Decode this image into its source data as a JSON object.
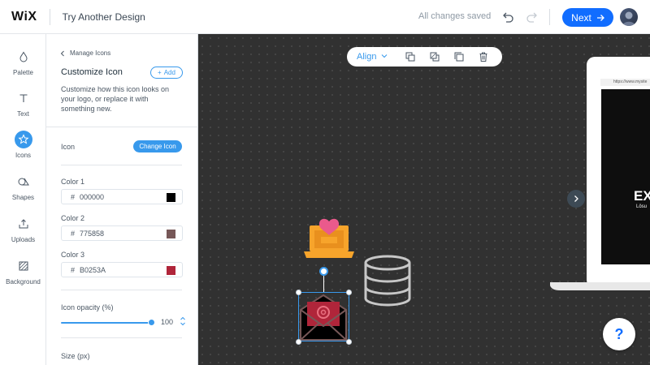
{
  "header": {
    "logo": "WiX",
    "title": "Try Another Design",
    "status": "All changes saved",
    "next_label": "Next"
  },
  "toolstrip": {
    "items": [
      {
        "label": "Palette",
        "icon": "palette-icon"
      },
      {
        "label": "Text",
        "icon": "text-icon"
      },
      {
        "label": "Icons",
        "icon": "star-icon",
        "active": true
      },
      {
        "label": "Shapes",
        "icon": "shapes-icon"
      },
      {
        "label": "Uploads",
        "icon": "upload-icon"
      },
      {
        "label": "Background",
        "icon": "background-icon"
      }
    ]
  },
  "panel": {
    "breadcrumb": "Manage Icons",
    "title": "Customize Icon",
    "add_label": "Add",
    "description": "Customize how this icon looks on your logo, or replace it with something new.",
    "icon_label": "Icon",
    "change_label": "Change Icon",
    "colors": [
      {
        "label": "Color 1",
        "hex": "000000",
        "swatch": "#000000"
      },
      {
        "label": "Color 2",
        "hex": "775858",
        "swatch": "#775858"
      },
      {
        "label": "Color 3",
        "hex": "B0253A",
        "swatch": "#B0253A"
      }
    ],
    "opacity_label": "Icon opacity (%)",
    "opacity_value": "100",
    "size_label": "Size (px)"
  },
  "canvas": {
    "align_label": "Align",
    "url_text": "https://www.mysite",
    "preview_text": "EX",
    "preview_sub": "Lösu",
    "help_label": "?"
  },
  "colors": {
    "accent": "#3899ec",
    "next_button": "#116dff",
    "canvas_bg": "#313131"
  }
}
